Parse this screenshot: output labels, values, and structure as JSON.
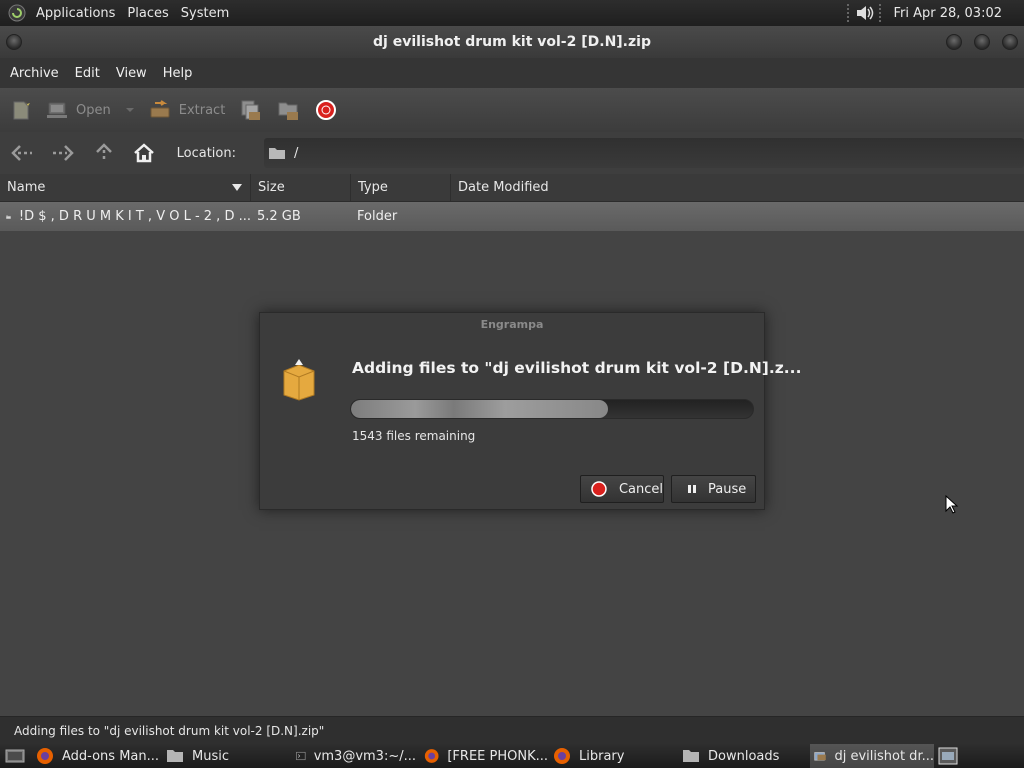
{
  "panel": {
    "menus": [
      "Applications",
      "Places",
      "System"
    ],
    "clock": "Fri Apr 28, 03:02"
  },
  "window": {
    "title": "dj evilishot drum kit vol-2 [D.N].zip"
  },
  "menubar": {
    "items": [
      "Archive",
      "Edit",
      "View",
      "Help"
    ]
  },
  "toolbar": {
    "open_label": "Open",
    "extract_label": "Extract"
  },
  "location": {
    "label": "Location:",
    "path": "/"
  },
  "file_list": {
    "columns": [
      "Name",
      "Size",
      "Type",
      "Date Modified"
    ],
    "rows": [
      {
        "name": "!D $ , D R U M K I T , V O L - 2 , D ...",
        "size": "5.2 GB",
        "type": "Folder",
        "date": ""
      }
    ]
  },
  "dialog": {
    "title": "Engrampa",
    "heading": "Adding files to \"dj evilishot drum kit vol-2 [D.N].z...",
    "progress": 0.64,
    "remaining": "1543 files remaining",
    "cancel_label": "Cancel",
    "pause_label": "Pause"
  },
  "statusbar": {
    "text": "Adding files to \"dj evilishot drum kit vol-2 [D.N].zip\""
  },
  "taskbar": {
    "tasks": [
      "Add-ons Man...",
      "Music",
      "vm3@vm3:~/...",
      "[FREE PHONK...",
      "Library",
      "Downloads",
      "dj evilishot dr..."
    ]
  },
  "colors": {
    "stop_red": "#d9211e",
    "archive_orange": "#e5a93f",
    "selection": "#5f5f5f"
  }
}
